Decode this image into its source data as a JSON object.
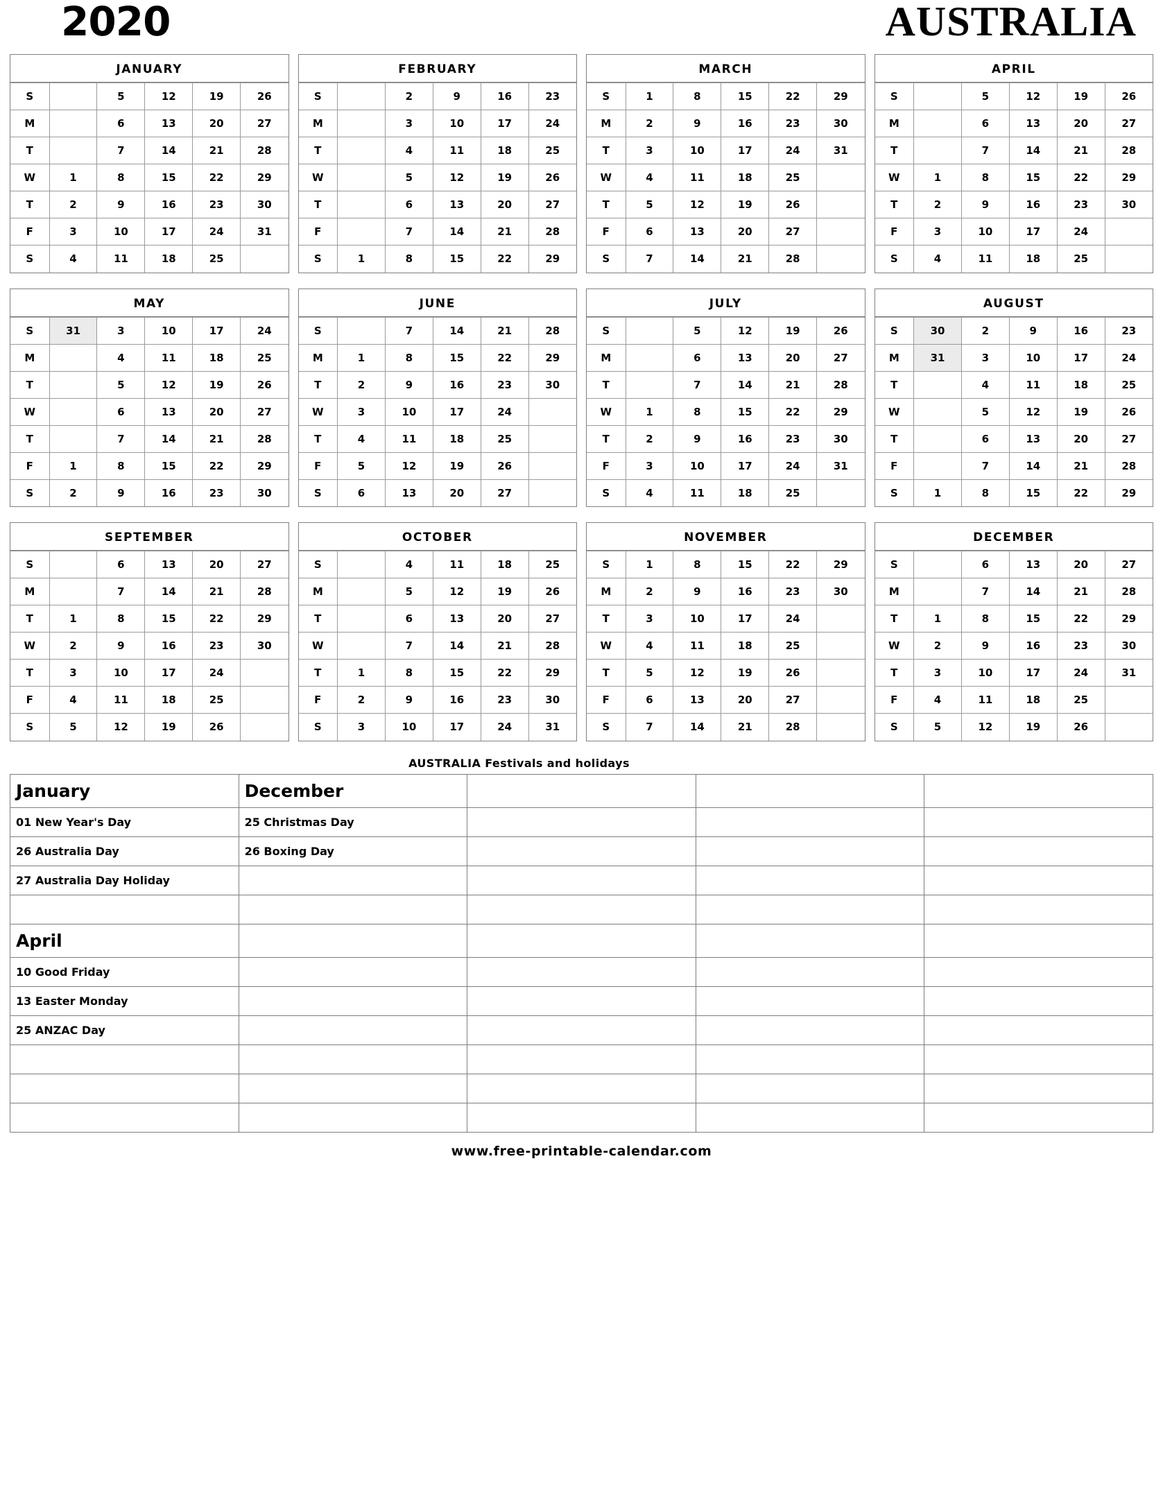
{
  "header": {
    "year": "2020",
    "country": "AUSTRALIA"
  },
  "dow_labels": [
    "S",
    "M",
    "T",
    "W",
    "T",
    "F",
    "S"
  ],
  "months": [
    {
      "name": "JANUARY",
      "rows": [
        [
          "",
          "5",
          "12",
          "19",
          "26"
        ],
        [
          "",
          "6",
          "13",
          "20",
          "27"
        ],
        [
          "",
          "7",
          "14",
          "21",
          "28"
        ],
        [
          "1",
          "8",
          "15",
          "22",
          "29"
        ],
        [
          "2",
          "9",
          "16",
          "23",
          "30"
        ],
        [
          "3",
          "10",
          "17",
          "24",
          "31"
        ],
        [
          "4",
          "11",
          "18",
          "25",
          ""
        ]
      ],
      "highlights": []
    },
    {
      "name": "FEBRUARY",
      "rows": [
        [
          "",
          "2",
          "9",
          "16",
          "23"
        ],
        [
          "",
          "3",
          "10",
          "17",
          "24"
        ],
        [
          "",
          "4",
          "11",
          "18",
          "25"
        ],
        [
          "",
          "5",
          "12",
          "19",
          "26"
        ],
        [
          "",
          "6",
          "13",
          "20",
          "27"
        ],
        [
          "",
          "7",
          "14",
          "21",
          "28"
        ],
        [
          "1",
          "8",
          "15",
          "22",
          "29"
        ]
      ],
      "highlights": []
    },
    {
      "name": "MARCH",
      "rows": [
        [
          "1",
          "8",
          "15",
          "22",
          "29"
        ],
        [
          "2",
          "9",
          "16",
          "23",
          "30"
        ],
        [
          "3",
          "10",
          "17",
          "24",
          "31"
        ],
        [
          "4",
          "11",
          "18",
          "25",
          ""
        ],
        [
          "5",
          "12",
          "19",
          "26",
          ""
        ],
        [
          "6",
          "13",
          "20",
          "27",
          ""
        ],
        [
          "7",
          "14",
          "21",
          "28",
          ""
        ]
      ],
      "highlights": []
    },
    {
      "name": "APRIL",
      "rows": [
        [
          "",
          "5",
          "12",
          "19",
          "26"
        ],
        [
          "",
          "6",
          "13",
          "20",
          "27"
        ],
        [
          "",
          "7",
          "14",
          "21",
          "28"
        ],
        [
          "1",
          "8",
          "15",
          "22",
          "29"
        ],
        [
          "2",
          "9",
          "16",
          "23",
          "30"
        ],
        [
          "3",
          "10",
          "17",
          "24",
          ""
        ],
        [
          "4",
          "11",
          "18",
          "25",
          ""
        ]
      ],
      "highlights": []
    },
    {
      "name": "MAY",
      "rows": [
        [
          "31",
          "3",
          "10",
          "17",
          "24"
        ],
        [
          "",
          "4",
          "11",
          "18",
          "25"
        ],
        [
          "",
          "5",
          "12",
          "19",
          "26"
        ],
        [
          "",
          "6",
          "13",
          "20",
          "27"
        ],
        [
          "",
          "7",
          "14",
          "21",
          "28"
        ],
        [
          "1",
          "8",
          "15",
          "22",
          "29"
        ],
        [
          "2",
          "9",
          "16",
          "23",
          "30"
        ]
      ],
      "highlights": [
        [
          0,
          0
        ]
      ]
    },
    {
      "name": "JUNE",
      "rows": [
        [
          "",
          "7",
          "14",
          "21",
          "28"
        ],
        [
          "1",
          "8",
          "15",
          "22",
          "29"
        ],
        [
          "2",
          "9",
          "16",
          "23",
          "30"
        ],
        [
          "3",
          "10",
          "17",
          "24",
          ""
        ],
        [
          "4",
          "11",
          "18",
          "25",
          ""
        ],
        [
          "5",
          "12",
          "19",
          "26",
          ""
        ],
        [
          "6",
          "13",
          "20",
          "27",
          ""
        ]
      ],
      "highlights": []
    },
    {
      "name": "JULY",
      "rows": [
        [
          "",
          "5",
          "12",
          "19",
          "26"
        ],
        [
          "",
          "6",
          "13",
          "20",
          "27"
        ],
        [
          "",
          "7",
          "14",
          "21",
          "28"
        ],
        [
          "1",
          "8",
          "15",
          "22",
          "29"
        ],
        [
          "2",
          "9",
          "16",
          "23",
          "30"
        ],
        [
          "3",
          "10",
          "17",
          "24",
          "31"
        ],
        [
          "4",
          "11",
          "18",
          "25",
          ""
        ]
      ],
      "highlights": []
    },
    {
      "name": "AUGUST",
      "rows": [
        [
          "30",
          "2",
          "9",
          "16",
          "23"
        ],
        [
          "31",
          "3",
          "10",
          "17",
          "24"
        ],
        [
          "",
          "4",
          "11",
          "18",
          "25"
        ],
        [
          "",
          "5",
          "12",
          "19",
          "26"
        ],
        [
          "",
          "6",
          "13",
          "20",
          "27"
        ],
        [
          "",
          "7",
          "14",
          "21",
          "28"
        ],
        [
          "1",
          "8",
          "15",
          "22",
          "29"
        ]
      ],
      "highlights": [
        [
          0,
          0
        ],
        [
          1,
          0
        ]
      ]
    },
    {
      "name": "SEPTEMBER",
      "rows": [
        [
          "",
          "6",
          "13",
          "20",
          "27"
        ],
        [
          "",
          "7",
          "14",
          "21",
          "28"
        ],
        [
          "1",
          "8",
          "15",
          "22",
          "29"
        ],
        [
          "2",
          "9",
          "16",
          "23",
          "30"
        ],
        [
          "3",
          "10",
          "17",
          "24",
          ""
        ],
        [
          "4",
          "11",
          "18",
          "25",
          ""
        ],
        [
          "5",
          "12",
          "19",
          "26",
          ""
        ]
      ],
      "highlights": []
    },
    {
      "name": "OCTOBER",
      "rows": [
        [
          "",
          "4",
          "11",
          "18",
          "25"
        ],
        [
          "",
          "5",
          "12",
          "19",
          "26"
        ],
        [
          "",
          "6",
          "13",
          "20",
          "27"
        ],
        [
          "",
          "7",
          "14",
          "21",
          "28"
        ],
        [
          "1",
          "8",
          "15",
          "22",
          "29"
        ],
        [
          "2",
          "9",
          "16",
          "23",
          "30"
        ],
        [
          "3",
          "10",
          "17",
          "24",
          "31"
        ]
      ],
      "highlights": []
    },
    {
      "name": "NOVEMBER",
      "rows": [
        [
          "1",
          "8",
          "15",
          "22",
          "29"
        ],
        [
          "2",
          "9",
          "16",
          "23",
          "30"
        ],
        [
          "3",
          "10",
          "17",
          "24",
          ""
        ],
        [
          "4",
          "11",
          "18",
          "25",
          ""
        ],
        [
          "5",
          "12",
          "19",
          "26",
          ""
        ],
        [
          "6",
          "13",
          "20",
          "27",
          ""
        ],
        [
          "7",
          "14",
          "21",
          "28",
          ""
        ]
      ],
      "highlights": []
    },
    {
      "name": "DECEMBER",
      "rows": [
        [
          "",
          "6",
          "13",
          "20",
          "27"
        ],
        [
          "",
          "7",
          "14",
          "21",
          "28"
        ],
        [
          "1",
          "8",
          "15",
          "22",
          "29"
        ],
        [
          "2",
          "9",
          "16",
          "23",
          "30"
        ],
        [
          "3",
          "10",
          "17",
          "24",
          "31"
        ],
        [
          "4",
          "11",
          "18",
          "25",
          ""
        ],
        [
          "5",
          "12",
          "19",
          "26",
          ""
        ]
      ],
      "highlights": []
    }
  ],
  "festivals": {
    "title": "AUSTRALIA Festivals and holidays",
    "columns": 5,
    "rows": [
      {
        "type": "head",
        "cells": [
          "January",
          "December",
          "",
          "",
          ""
        ]
      },
      {
        "type": "item",
        "cells": [
          "01 New Year's Day",
          "25  Christmas Day",
          "",
          "",
          ""
        ]
      },
      {
        "type": "item",
        "cells": [
          "26 Australia Day",
          "26 Boxing Day",
          "",
          "",
          ""
        ]
      },
      {
        "type": "item",
        "cells": [
          "27 Australia Day Holiday",
          "",
          "",
          "",
          ""
        ]
      },
      {
        "type": "blank",
        "cells": [
          "",
          "",
          "",
          "",
          ""
        ]
      },
      {
        "type": "head",
        "cells": [
          "April",
          "",
          "",
          "",
          ""
        ]
      },
      {
        "type": "item",
        "cells": [
          "10 Good Friday",
          "",
          "",
          "",
          ""
        ]
      },
      {
        "type": "item",
        "cells": [
          "13 Easter Monday",
          "",
          "",
          "",
          ""
        ]
      },
      {
        "type": "item",
        "cells": [
          "25 ANZAC Day",
          "",
          "",
          "",
          ""
        ]
      },
      {
        "type": "blank",
        "cells": [
          "",
          "",
          "",
          "",
          ""
        ]
      },
      {
        "type": "blank",
        "cells": [
          "",
          "",
          "",
          "",
          ""
        ]
      },
      {
        "type": "blank",
        "cells": [
          "",
          "",
          "",
          "",
          ""
        ]
      }
    ]
  },
  "footer": {
    "url": "www.free-printable-calendar.com"
  }
}
